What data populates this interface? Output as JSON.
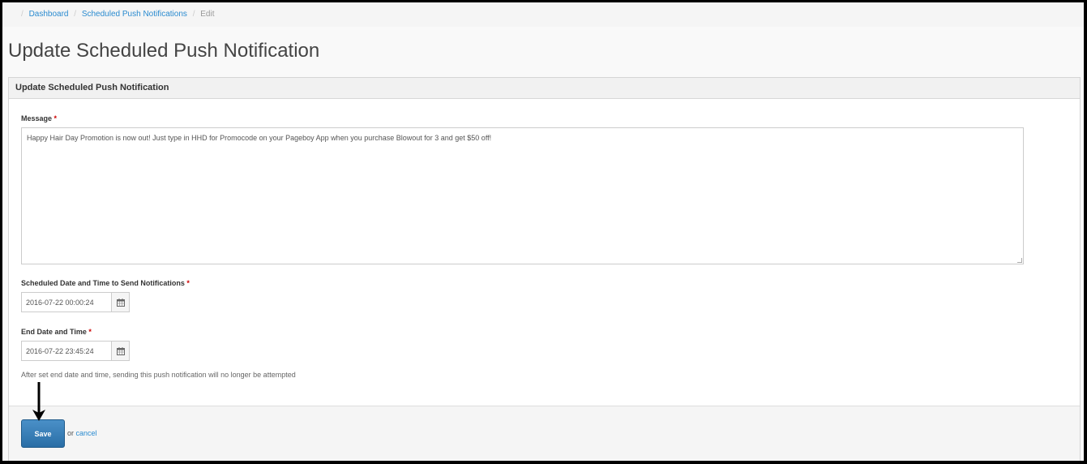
{
  "breadcrumb": {
    "items": [
      "Dashboard",
      "Scheduled Push Notifications"
    ],
    "current": "Edit",
    "separator": "/"
  },
  "page": {
    "title": "Update Scheduled Push Notification"
  },
  "panel": {
    "heading": "Update Scheduled Push Notification",
    "message": {
      "label": "Message",
      "required": "*",
      "value": "Happy Hair Day Promotion is now out! Just type in HHD for Promocode on your Pageboy App when you purchase Blowout for 3 and get $50 off!"
    },
    "scheduled": {
      "label": "Scheduled Date and Time to Send Notifications",
      "required": "*",
      "value": "2016-07-22 00:00:24",
      "icon": "calendar-icon"
    },
    "end": {
      "label": "End Date and Time",
      "required": "*",
      "value": "2016-07-22 23:45:24",
      "icon": "calendar-icon",
      "help": "After set end date and time, sending this push notification will no longer be attempted"
    }
  },
  "footer": {
    "save_label": "Save",
    "or_text": "or",
    "cancel_label": "cancel"
  },
  "annotation": {
    "icon": "down-arrow-icon",
    "color": "#000000"
  }
}
